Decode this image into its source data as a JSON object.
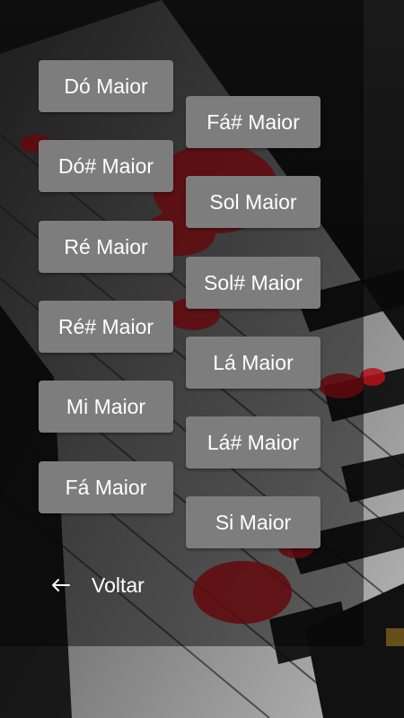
{
  "chords": {
    "left": [
      {
        "label": "Dó Maior"
      },
      {
        "label": "Dó# Maior"
      },
      {
        "label": "Ré Maior"
      },
      {
        "label": "Ré# Maior"
      },
      {
        "label": "Mi Maior"
      },
      {
        "label": "Fá Maior"
      }
    ],
    "right": [
      {
        "label": "Fá# Maior"
      },
      {
        "label": "Sol Maior"
      },
      {
        "label": "Sol# Maior"
      },
      {
        "label": "Lá Maior"
      },
      {
        "label": "Lá# Maior"
      },
      {
        "label": "Si Maior"
      }
    ]
  },
  "back": {
    "icon": "arrow-left-icon",
    "label": "Voltar"
  },
  "colors": {
    "button_bg": "#7d7d7d",
    "button_text": "#ffffff",
    "rose_red": "#b3121a"
  }
}
